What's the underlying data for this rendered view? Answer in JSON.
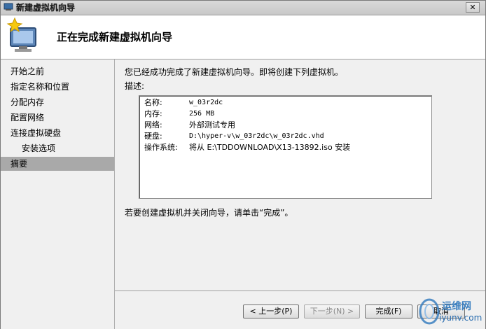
{
  "window": {
    "title": "新建虚拟机向导",
    "close_glyph": "✕"
  },
  "header": {
    "title": "正在完成新建虚拟机向导"
  },
  "sidebar": {
    "items": [
      {
        "label": "开始之前"
      },
      {
        "label": "指定名称和位置"
      },
      {
        "label": "分配内存"
      },
      {
        "label": "配置网络"
      },
      {
        "label": "连接虚拟硬盘"
      },
      {
        "label": "安装选项"
      },
      {
        "label": "摘要"
      }
    ]
  },
  "content": {
    "intro": "您已经成功完成了新建虚拟机向导。即将创建下列虚拟机。",
    "desc_label": "描述:",
    "summary": [
      {
        "key": "名称:",
        "value": "w_03r2dc"
      },
      {
        "key": "内存:",
        "value": "256 MB"
      },
      {
        "key": "网络:",
        "value": "外部测试专用"
      },
      {
        "key": "硬盘:",
        "value": "D:\\hyper-v\\w_03r2dc\\w_03r2dc.vhd"
      },
      {
        "key": "操作系统:",
        "value": "将从 E:\\TDDOWNLOAD\\X13-13892.iso 安装"
      }
    ],
    "footer_note": "若要创建虚拟机并关闭向导，请单击“完成”。"
  },
  "buttons": {
    "prev": "< 上一步(P)",
    "next": "下一步(N) >",
    "finish": "完成(F)",
    "cancel": "取消"
  },
  "watermark": {
    "line1": "运维网",
    "line2": "iyunv.com"
  },
  "colors": {
    "active_item": "#a9a9a9",
    "watermark": "#3a7fc0"
  }
}
